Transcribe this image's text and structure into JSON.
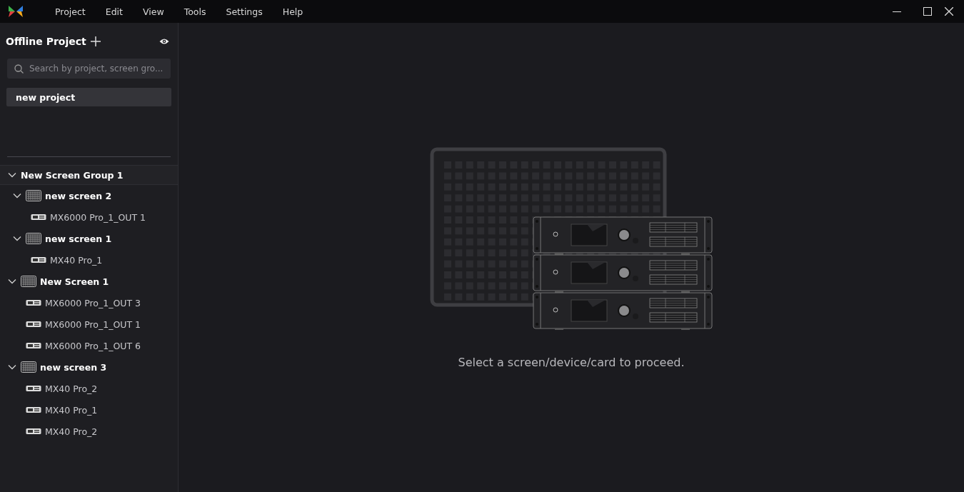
{
  "menu": [
    "Project",
    "Edit",
    "View",
    "Tools",
    "Settings",
    "Help"
  ],
  "sidebar": {
    "title": "Offline Project",
    "search": {
      "placeholder": "Search by project, screen gro..."
    },
    "projects": [
      {
        "label": "new project",
        "selected": true
      }
    ],
    "tree": [
      {
        "kind": "group",
        "label": "New Screen Group 1",
        "expanded": true,
        "children": [
          {
            "kind": "screen",
            "label": "new screen 2",
            "expanded": true,
            "children": [
              {
                "kind": "device",
                "label": "MX6000 Pro_1_OUT 1"
              }
            ]
          },
          {
            "kind": "screen",
            "label": "new screen 1",
            "expanded": true,
            "children": [
              {
                "kind": "device",
                "label": "MX40 Pro_1"
              }
            ]
          }
        ]
      },
      {
        "kind": "screen",
        "label": "New Screen 1",
        "expanded": true,
        "children": [
          {
            "kind": "device",
            "label": "MX6000 Pro_1_OUT 3"
          },
          {
            "kind": "device",
            "label": "MX6000 Pro_1_OUT 1"
          },
          {
            "kind": "device",
            "label": "MX6000 Pro_1_OUT 6"
          }
        ]
      },
      {
        "kind": "screen",
        "label": "new screen 3",
        "expanded": true,
        "children": [
          {
            "kind": "device",
            "label": "MX40 Pro_2"
          },
          {
            "kind": "device",
            "label": "MX40 Pro_1"
          },
          {
            "kind": "device",
            "label": "MX40 Pro_2"
          }
        ]
      }
    ]
  },
  "main": {
    "message": "Select a screen/device/card to proceed."
  }
}
